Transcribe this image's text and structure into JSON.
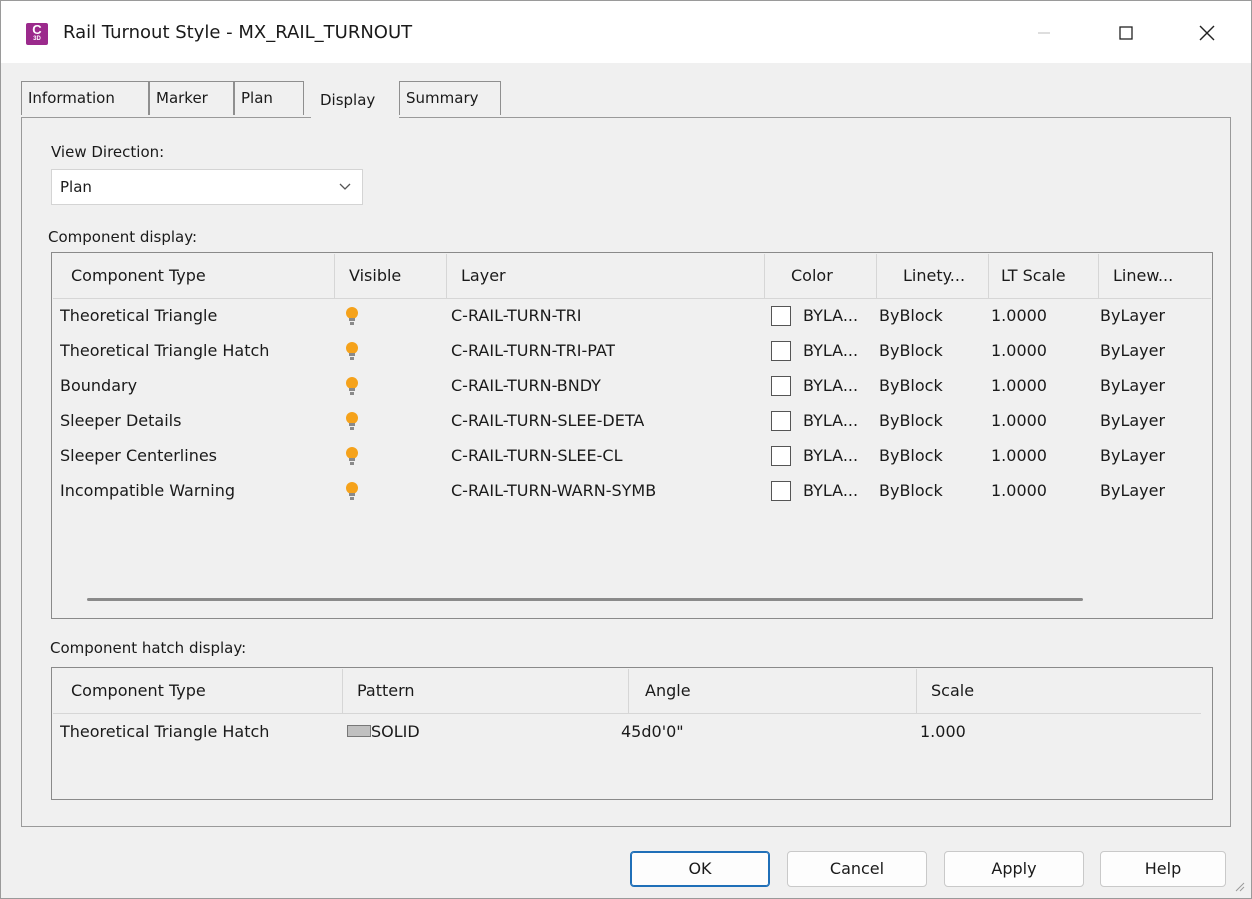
{
  "window": {
    "icon_letter": "C",
    "icon_subtext": "3D",
    "title": "Rail Turnout Style - MX_RAIL_TURNOUT",
    "icon_color": "#9b2a8c"
  },
  "tabs": [
    {
      "label": "Information"
    },
    {
      "label": "Marker"
    },
    {
      "label": "Plan"
    },
    {
      "label": "Display",
      "active": true
    },
    {
      "label": "Summary"
    }
  ],
  "view_direction": {
    "label": "View Direction:",
    "value": "Plan"
  },
  "component_display": {
    "label": "Component display:",
    "columns": [
      "Component Type",
      "Visible",
      "Layer",
      "Color",
      "Linety...",
      "LT Scale",
      "Linew..."
    ],
    "rows": [
      {
        "type": "Theoretical Triangle",
        "layer": "C-RAIL-TURN-TRI",
        "color": "BYLA...",
        "linetype": "ByBlock",
        "lt_scale": "1.0000",
        "lineweight": "ByLayer"
      },
      {
        "type": "Theoretical Triangle Hatch",
        "layer": "C-RAIL-TURN-TRI-PAT",
        "color": "BYLA...",
        "linetype": "ByBlock",
        "lt_scale": "1.0000",
        "lineweight": "ByLayer"
      },
      {
        "type": "Boundary",
        "layer": "C-RAIL-TURN-BNDY",
        "color": "BYLA...",
        "linetype": "ByBlock",
        "lt_scale": "1.0000",
        "lineweight": "ByLayer"
      },
      {
        "type": "Sleeper Details",
        "layer": "C-RAIL-TURN-SLEE-DETA",
        "color": "BYLA...",
        "linetype": "ByBlock",
        "lt_scale": "1.0000",
        "lineweight": "ByLayer"
      },
      {
        "type": "Sleeper Centerlines",
        "layer": "C-RAIL-TURN-SLEE-CL",
        "color": "BYLA...",
        "linetype": "ByBlock",
        "lt_scale": "1.0000",
        "lineweight": "ByLayer"
      },
      {
        "type": "Incompatible Warning",
        "layer": "C-RAIL-TURN-WARN-SYMB",
        "color": "BYLA...",
        "linetype": "ByBlock",
        "lt_scale": "1.0000",
        "lineweight": "ByLayer"
      }
    ]
  },
  "hatch_display": {
    "label": "Component hatch display:",
    "columns": [
      "Component Type",
      "Pattern",
      "Angle",
      "Scale"
    ],
    "rows": [
      {
        "type": "Theoretical Triangle Hatch",
        "pattern": "SOLID",
        "angle": "45d0'0\"",
        "scale": "1.000"
      }
    ]
  },
  "buttons": {
    "ok": "OK",
    "cancel": "Cancel",
    "apply": "Apply",
    "help": "Help"
  },
  "colors": {
    "bulb_on": "#f5a21b",
    "accent": "#1f6fb8"
  }
}
